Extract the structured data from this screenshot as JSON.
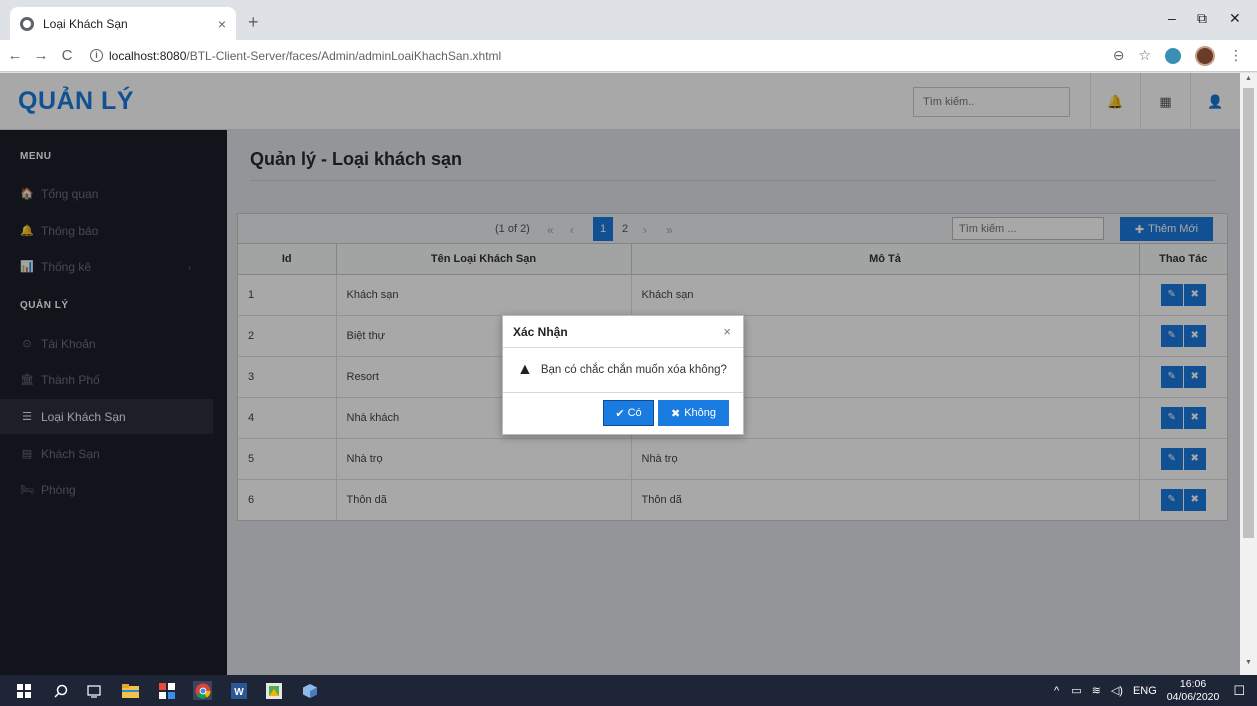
{
  "browser": {
    "tab_title": "Loại Khách Sạn",
    "tab_close": "×",
    "new_tab": "+",
    "window_controls": {
      "minimize": "–",
      "maximize": "⧉",
      "close": "✕"
    },
    "nav": {
      "back": "←",
      "forward": "→",
      "reload": "C"
    },
    "url_host": "localhost:8080",
    "url_path": "/BTL-Client-Server/faces/Admin/adminLoaiKhachSan.xhtml",
    "info_icon": "i",
    "zoom_icon": "⊖",
    "star_icon": "☆",
    "menu_icon": "⋮"
  },
  "header": {
    "brand": "QUẢN LÝ",
    "search_placeholder": "Tìm kiếm..",
    "bell_icon": "🔔",
    "grid_icon": "▦",
    "user_icon": "👤"
  },
  "sidebar": {
    "section_menu": "MENU",
    "section_manage": "QUẢN LÝ",
    "items": [
      {
        "label": "Tổng quan",
        "icon": "🏠"
      },
      {
        "label": "Thông báo",
        "icon": "🔔"
      },
      {
        "label": "Thống kê",
        "icon": "📊",
        "arrow": "›"
      },
      {
        "label": "Tài Khoản",
        "icon": "⊙"
      },
      {
        "label": "Thành Phố",
        "icon": "🏛"
      },
      {
        "label": "Loại Khách Sạn",
        "icon": "☰",
        "active": true
      },
      {
        "label": "Khách Sạn",
        "icon": "▤"
      },
      {
        "label": "Phòng",
        "icon": "🛏"
      }
    ]
  },
  "main": {
    "page_title": "Quản lý - Loại khách sạn",
    "paginator": {
      "summary": "(1 of 2)",
      "first": "«",
      "prev": "‹",
      "pages": [
        "1",
        "2"
      ],
      "current": "1",
      "next": "›",
      "last": "»",
      "search_placeholder": "Tìm kiếm ...",
      "add_label": "Thêm Mới",
      "add_icon": "✚"
    },
    "table": {
      "headers": [
        "Id",
        "Tên Loại Khách Sạn",
        "Mô Tả",
        "Thao Tác"
      ],
      "rows": [
        {
          "id": "1",
          "name": "Khách sạn",
          "desc": "Khách sạn"
        },
        {
          "id": "2",
          "name": "Biệt thự",
          "desc": ""
        },
        {
          "id": "3",
          "name": "Resort",
          "desc": ""
        },
        {
          "id": "4",
          "name": "Nhà khách",
          "desc": ""
        },
        {
          "id": "5",
          "name": "Nhà trọ",
          "desc": "Nhà trọ"
        },
        {
          "id": "6",
          "name": "Thôn dã",
          "desc": "Thôn dã"
        }
      ],
      "edit_icon": "✎",
      "delete_icon": "✖"
    }
  },
  "dialog": {
    "title": "Xác Nhận",
    "close": "×",
    "message": "Bạn có chắc chắn muốn xóa không?",
    "warn_icon": "▲",
    "yes_label": "Có",
    "yes_icon": "✔",
    "no_label": "Không",
    "no_icon": "✖"
  },
  "taskbar": {
    "lang": "ENG",
    "time": "16:06",
    "date": "04/06/2020",
    "tray_arrow": "^"
  }
}
